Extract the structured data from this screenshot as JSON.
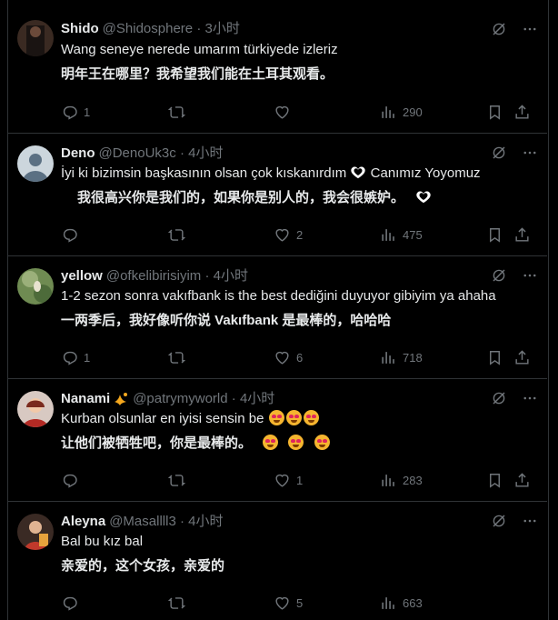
{
  "replies": [
    {
      "name": "Shido",
      "handle": "@Shidosphere",
      "time": "3小时",
      "text": "Wang seneye nerede umarım türkiyede izleriz",
      "translation": "明年王在哪里？我希望我们能在土耳其观看。",
      "replies_count": "1",
      "retweets_count": "",
      "likes_count": "",
      "views_count": "290"
    },
    {
      "name": "Deno",
      "handle": "@DenoUk3c",
      "time": "4小时",
      "text_before_emoji": "İyi ki bizimsin başkasının olsan çok kıskanırdım",
      "text_after_emoji": "Canımız Yoyomuz",
      "translation": "我很高兴你是我们的，如果你是别人的，我会很嫉妒。",
      "replies_count": "",
      "retweets_count": "",
      "likes_count": "2",
      "views_count": "475"
    },
    {
      "name": "yellow",
      "handle": "@ofkelibirisiyim",
      "time": "4小时",
      "text": "1-2 sezon sonra vakıfbank is the best dediğini duyuyor gibiyim ya ahaha",
      "translation": "一两季后，我好像听你说 Vakıfbank 是最棒的，哈哈哈",
      "replies_count": "1",
      "retweets_count": "",
      "likes_count": "6",
      "views_count": "718"
    },
    {
      "name": "Nanami",
      "handle": "@patrymyworld",
      "time": "4小时",
      "text": "Kurban olsunlar en iyisi sensin be",
      "translation": "让他们被牺牲吧，你是最棒的。",
      "replies_count": "",
      "retweets_count": "",
      "likes_count": "1",
      "views_count": "283"
    },
    {
      "name": "Aleyna",
      "handle": "@Masallll3",
      "time": "4小时",
      "text": "Bal bu kız bal",
      "translation": "亲爱的，这个女孩，亲爱的",
      "replies_count": "",
      "retweets_count": "",
      "likes_count": "5",
      "views_count": "663"
    }
  ],
  "separator": "·",
  "icons": {
    "grok": "grok-icon",
    "more": "more-icon",
    "reply": "reply-icon",
    "retweet": "retweet-icon",
    "like": "like-icon",
    "views": "views-icon",
    "bookmark": "bookmark-icon",
    "share": "share-icon"
  },
  "colors": {
    "background": "#000000",
    "text": "#e7e9ea",
    "muted": "#71767b",
    "border": "#2f3336"
  }
}
